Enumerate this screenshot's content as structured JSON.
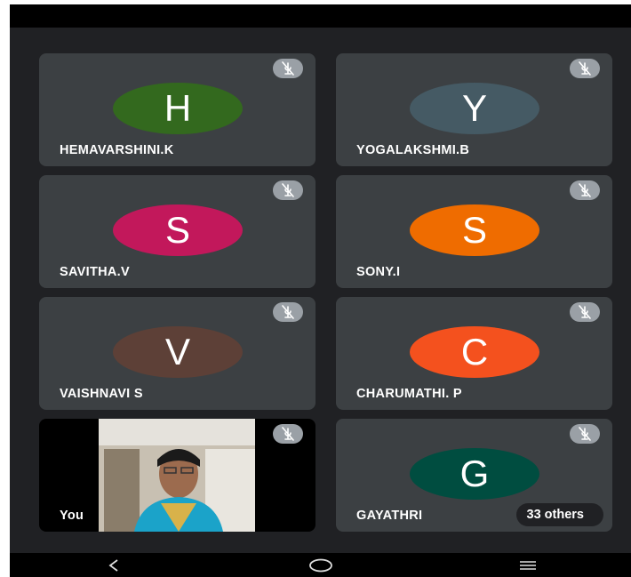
{
  "participants": [
    {
      "name": "HEMAVARSHINI.K",
      "initial": "H",
      "color": "#33691e"
    },
    {
      "name": "YOGALAKSHMI.B",
      "initial": "Y",
      "color": "#455a64"
    },
    {
      "name": "SAVITHA.V",
      "initial": "S",
      "color": "#c2185b"
    },
    {
      "name": "SONY.I",
      "initial": "S",
      "color": "#ef6c00"
    },
    {
      "name": "VAISHNAVI S",
      "initial": "V",
      "color": "#5d4037"
    },
    {
      "name": "CHARUMATHI. P",
      "initial": "C",
      "color": "#f4511e"
    },
    {
      "name": "GAYATHRI",
      "initial": "G",
      "color": "#004d40"
    }
  ],
  "self": {
    "label": "You"
  },
  "others_label": "33 others",
  "icons": {
    "mute": "mic-off-icon",
    "back": "nav-back-icon",
    "home": "nav-home-icon",
    "recents": "nav-recents-icon"
  }
}
